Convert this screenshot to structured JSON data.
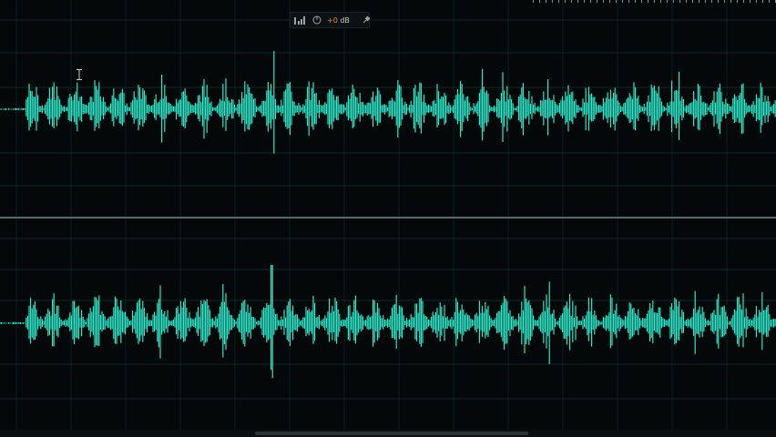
{
  "hud": {
    "gain_sign": "+",
    "gain_value": "0",
    "gain_unit": "dB",
    "icons": [
      "volume-bars-icon",
      "gain-knob-icon",
      "pin-icon"
    ]
  },
  "colors": {
    "background": "#050808",
    "grid": "#0f2a28",
    "waveform": "#2ee6c8",
    "divider": "#7c8a8c",
    "gain_accent": "#e08a3a"
  },
  "channels": [
    {
      "id": "left"
    },
    {
      "id": "right"
    }
  ]
}
